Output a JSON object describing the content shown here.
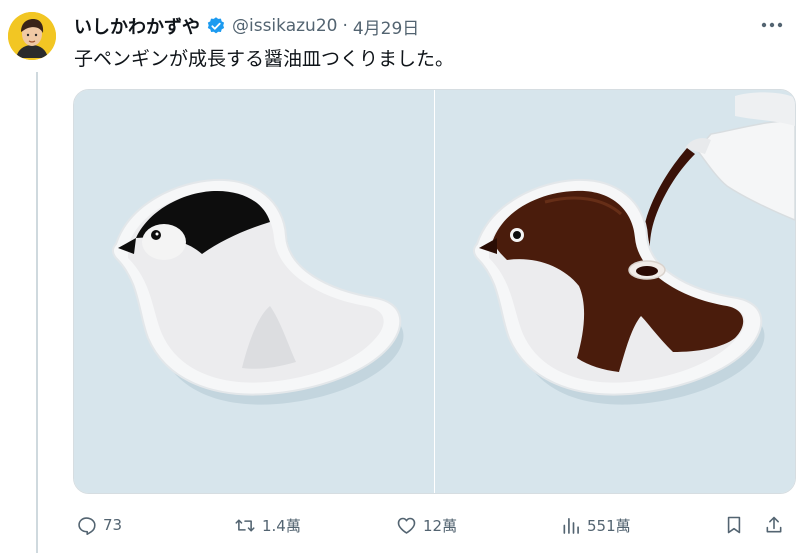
{
  "tweet": {
    "display_name": "いしかわかずや",
    "handle": "@issikazu20",
    "separator": "·",
    "date": "4月29日",
    "text": "子ペンギンが成長する醤油皿つくりました。"
  },
  "media": [
    {
      "icon": "penguin-dish-empty-image"
    },
    {
      "icon": "penguin-dish-soy-sauce-image"
    }
  ],
  "actions": {
    "reply_count": "73",
    "retweet_count": "1.4萬",
    "like_count": "12萬",
    "views_count": "551萬"
  },
  "icons": {
    "verified": "verified-badge-icon",
    "more": "more-icon",
    "reply": "reply-icon",
    "retweet": "retweet-icon",
    "like": "heart-icon",
    "views": "views-icon",
    "bookmark": "bookmark-icon",
    "share": "share-icon"
  },
  "colors": {
    "verified": "#1d9bf0",
    "muted": "#536471",
    "text": "#0f1419",
    "media_bg": "#d7e5ec",
    "soy_sauce": "#4a1c0c"
  }
}
